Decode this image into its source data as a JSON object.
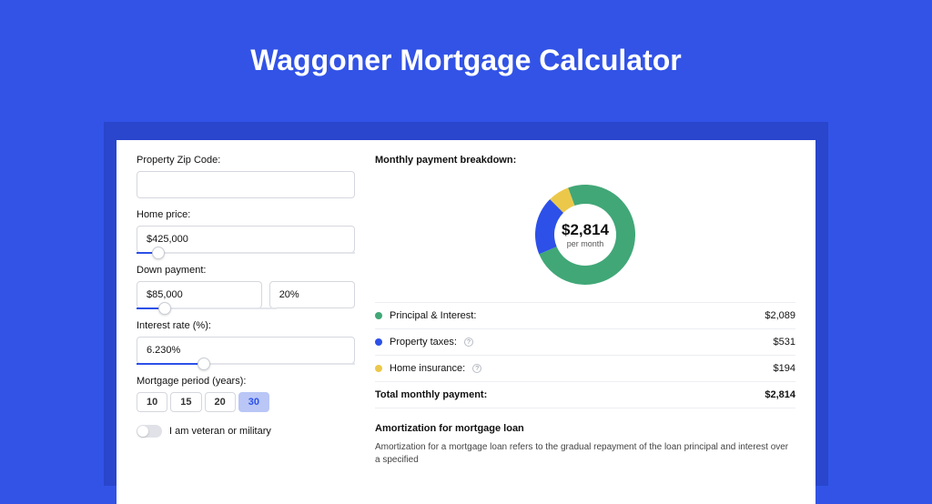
{
  "page_title": "Waggoner Mortgage Calculator",
  "form": {
    "zip_label": "Property Zip Code:",
    "zip_value": "",
    "home_price_label": "Home price:",
    "home_price_value": "$425,000",
    "home_price_slider_pct": 10,
    "down_payment_label": "Down payment:",
    "down_payment_value": "$85,000",
    "down_payment_pct_value": "20%",
    "down_payment_slider_pct": 20,
    "interest_label": "Interest rate (%):",
    "interest_value": "6.230%",
    "interest_slider_pct": 31,
    "period_label": "Mortgage period (years):",
    "period_options": [
      "10",
      "15",
      "20",
      "30"
    ],
    "period_selected": "30",
    "veteran_label": "I am veteran or military",
    "veteran_on": false
  },
  "breakdown": {
    "title": "Monthly payment breakdown:",
    "center_amount": "$2,814",
    "center_sub": "per month",
    "rows": [
      {
        "key": "pi",
        "label": "Principal & Interest:",
        "value": "$2,089",
        "info": false
      },
      {
        "key": "tax",
        "label": "Property taxes:",
        "value": "$531",
        "info": true
      },
      {
        "key": "ins",
        "label": "Home insurance:",
        "value": "$194",
        "info": true
      }
    ],
    "total_label": "Total monthly payment:",
    "total_value": "$2,814"
  },
  "amortization": {
    "title": "Amortization for mortgage loan",
    "body": "Amortization for a mortgage loan refers to the gradual repayment of the loan principal and interest over a specified"
  },
  "chart_data": {
    "type": "pie",
    "title": "Monthly payment breakdown",
    "series": [
      {
        "name": "Principal & Interest",
        "value": 2089,
        "color": "#41a777"
      },
      {
        "name": "Property taxes",
        "value": 531,
        "color": "#2c50e8"
      },
      {
        "name": "Home insurance",
        "value": 194,
        "color": "#ecc84a"
      }
    ],
    "total": 2814,
    "center_label": "$2,814 per month"
  }
}
